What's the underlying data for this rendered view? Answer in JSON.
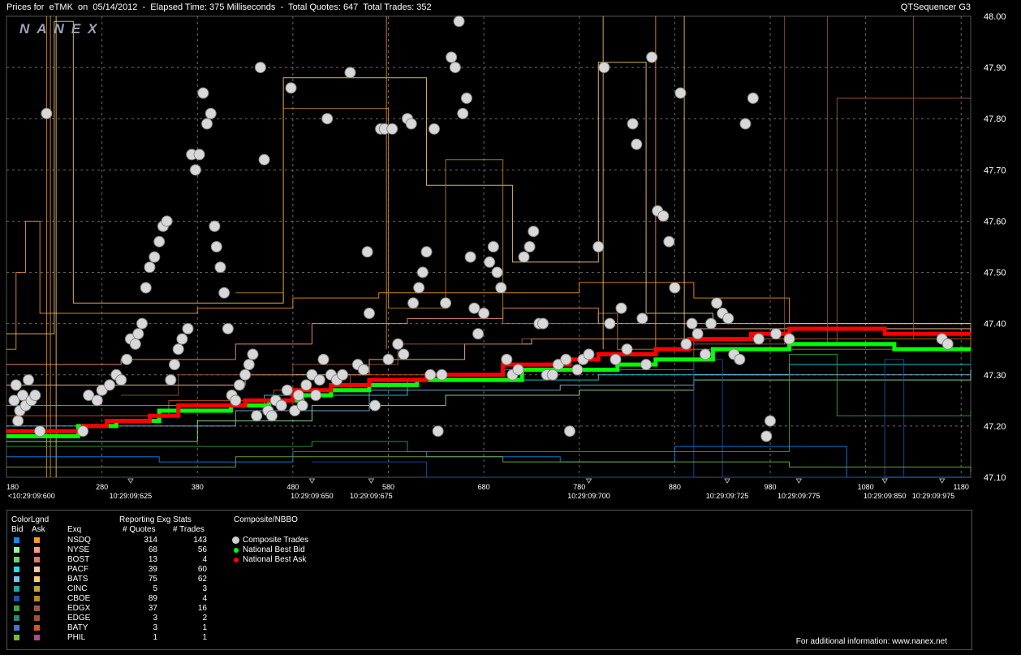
{
  "header": {
    "title": "Prices for  eTMK  on  05/14/2012  -  Elapsed Time: 375 Milliseconds  -  Total Quotes: 647  Total Trades: 352",
    "app_name": "QTSequencer G3",
    "watermark": "NANEX"
  },
  "chart_data": {
    "type": "scatter",
    "title": "Prices for eTMK on 05/14/2012",
    "ylim": [
      47.1,
      48.0
    ],
    "y_ticks": [
      "48.00",
      "47.90",
      "47.80",
      "47.70",
      "47.60",
      "47.50",
      "47.40",
      "47.30",
      "47.20",
      "47.10"
    ],
    "xlim": [
      180,
      1190
    ],
    "x_ticks": [
      "180",
      "280",
      "380",
      "480",
      "580",
      "680",
      "780",
      "880",
      "980",
      "1080",
      "1180"
    ],
    "x_tick_values": [
      180,
      280,
      380,
      480,
      580,
      680,
      780,
      880,
      980,
      1080,
      1180
    ],
    "time_labels": [
      {
        "x": 180,
        "label": "<10:29:09:600"
      },
      {
        "x": 310,
        "label": "10:29:09:625"
      },
      {
        "x": 500,
        "label": "10:29:09:650"
      },
      {
        "x": 562,
        "label": "10:29:09:675"
      },
      {
        "x": 790,
        "label": "10:29:09:700"
      },
      {
        "x": 935,
        "label": "10:29:09:725"
      },
      {
        "x": 1010,
        "label": "10:29:09:775"
      },
      {
        "x": 1100,
        "label": "10:29:09:850"
      },
      {
        "x": 1160,
        "label": "10:29:09:975"
      }
    ],
    "grid": true,
    "nbbo_bid": [
      [
        180,
        47.18
      ],
      [
        255,
        47.18
      ],
      [
        255,
        47.2
      ],
      [
        295,
        47.2
      ],
      [
        295,
        47.21
      ],
      [
        340,
        47.21
      ],
      [
        340,
        47.23
      ],
      [
        415,
        47.23
      ],
      [
        415,
        47.24
      ],
      [
        455,
        47.24
      ],
      [
        455,
        47.25
      ],
      [
        490,
        47.25
      ],
      [
        490,
        47.26
      ],
      [
        520,
        47.26
      ],
      [
        520,
        47.27
      ],
      [
        560,
        47.27
      ],
      [
        560,
        47.28
      ],
      [
        610,
        47.28
      ],
      [
        610,
        47.29
      ],
      [
        720,
        47.29
      ],
      [
        720,
        47.31
      ],
      [
        820,
        47.31
      ],
      [
        820,
        47.32
      ],
      [
        860,
        47.32
      ],
      [
        860,
        47.33
      ],
      [
        920,
        47.33
      ],
      [
        920,
        47.35
      ],
      [
        1000,
        47.35
      ],
      [
        1000,
        47.36
      ],
      [
        1110,
        47.36
      ],
      [
        1110,
        47.35
      ],
      [
        1190,
        47.35
      ]
    ],
    "nbbo_ask": [
      [
        180,
        47.19
      ],
      [
        260,
        47.19
      ],
      [
        260,
        47.2
      ],
      [
        285,
        47.2
      ],
      [
        285,
        47.21
      ],
      [
        330,
        47.21
      ],
      [
        330,
        47.22
      ],
      [
        360,
        47.22
      ],
      [
        360,
        47.24
      ],
      [
        430,
        47.24
      ],
      [
        430,
        47.25
      ],
      [
        480,
        47.25
      ],
      [
        480,
        47.27
      ],
      [
        520,
        47.27
      ],
      [
        520,
        47.28
      ],
      [
        560,
        47.28
      ],
      [
        560,
        47.29
      ],
      [
        620,
        47.29
      ],
      [
        620,
        47.3
      ],
      [
        700,
        47.3
      ],
      [
        700,
        47.32
      ],
      [
        770,
        47.32
      ],
      [
        770,
        47.33
      ],
      [
        800,
        47.33
      ],
      [
        800,
        47.34
      ],
      [
        860,
        47.34
      ],
      [
        860,
        47.35
      ],
      [
        895,
        47.35
      ],
      [
        895,
        47.37
      ],
      [
        960,
        47.37
      ],
      [
        960,
        47.38
      ],
      [
        1000,
        47.38
      ],
      [
        1000,
        47.39
      ],
      [
        1100,
        47.39
      ],
      [
        1100,
        47.38
      ],
      [
        1190,
        47.38
      ]
    ],
    "trades": [
      [
        188,
        47.25
      ],
      [
        190,
        47.28
      ],
      [
        192,
        47.21
      ],
      [
        194,
        47.23
      ],
      [
        197,
        47.26
      ],
      [
        200,
        47.24
      ],
      [
        203,
        47.29
      ],
      [
        206,
        47.25
      ],
      [
        210,
        47.26
      ],
      [
        215,
        47.19
      ],
      [
        222,
        47.81
      ],
      [
        260,
        47.19
      ],
      [
        266,
        47.26
      ],
      [
        275,
        47.25
      ],
      [
        280,
        47.27
      ],
      [
        288,
        47.28
      ],
      [
        295,
        47.3
      ],
      [
        300,
        47.29
      ],
      [
        306,
        47.33
      ],
      [
        310,
        47.37
      ],
      [
        315,
        47.36
      ],
      [
        318,
        47.38
      ],
      [
        322,
        47.4
      ],
      [
        326,
        47.47
      ],
      [
        330,
        47.51
      ],
      [
        335,
        47.53
      ],
      [
        340,
        47.56
      ],
      [
        344,
        47.59
      ],
      [
        348,
        47.6
      ],
      [
        352,
        47.29
      ],
      [
        356,
        47.32
      ],
      [
        360,
        47.35
      ],
      [
        364,
        47.37
      ],
      [
        370,
        47.39
      ],
      [
        374,
        47.73
      ],
      [
        378,
        47.7
      ],
      [
        382,
        47.73
      ],
      [
        386,
        47.85
      ],
      [
        390,
        47.79
      ],
      [
        394,
        47.81
      ],
      [
        398,
        47.59
      ],
      [
        400,
        47.55
      ],
      [
        404,
        47.51
      ],
      [
        408,
        47.46
      ],
      [
        412,
        47.39
      ],
      [
        416,
        47.26
      ],
      [
        420,
        47.25
      ],
      [
        424,
        47.28
      ],
      [
        430,
        47.3
      ],
      [
        434,
        47.32
      ],
      [
        438,
        47.34
      ],
      [
        442,
        47.22
      ],
      [
        446,
        47.9
      ],
      [
        450,
        47.72
      ],
      [
        454,
        47.23
      ],
      [
        458,
        47.22
      ],
      [
        462,
        47.25
      ],
      [
        468,
        47.24
      ],
      [
        474,
        47.27
      ],
      [
        478,
        47.86
      ],
      [
        482,
        47.23
      ],
      [
        486,
        47.26
      ],
      [
        490,
        47.24
      ],
      [
        494,
        47.28
      ],
      [
        500,
        47.3
      ],
      [
        504,
        47.26
      ],
      [
        508,
        47.29
      ],
      [
        512,
        47.33
      ],
      [
        516,
        47.8
      ],
      [
        520,
        47.3
      ],
      [
        526,
        47.29
      ],
      [
        532,
        47.3
      ],
      [
        540,
        47.89
      ],
      [
        548,
        47.32
      ],
      [
        554,
        47.31
      ],
      [
        558,
        47.54
      ],
      [
        560,
        47.42
      ],
      [
        566,
        47.24
      ],
      [
        572,
        47.78
      ],
      [
        576,
        47.78
      ],
      [
        580,
        47.33
      ],
      [
        584,
        47.78
      ],
      [
        590,
        47.36
      ],
      [
        596,
        47.34
      ],
      [
        600,
        47.8
      ],
      [
        604,
        47.79
      ],
      [
        606,
        47.44
      ],
      [
        612,
        47.47
      ],
      [
        616,
        47.5
      ],
      [
        620,
        47.54
      ],
      [
        624,
        47.3
      ],
      [
        628,
        47.78
      ],
      [
        632,
        47.19
      ],
      [
        636,
        47.3
      ],
      [
        640,
        47.44
      ],
      [
        646,
        47.92
      ],
      [
        650,
        47.9
      ],
      [
        654,
        47.99
      ],
      [
        658,
        47.81
      ],
      [
        662,
        47.84
      ],
      [
        666,
        47.53
      ],
      [
        670,
        47.43
      ],
      [
        674,
        47.38
      ],
      [
        680,
        47.42
      ],
      [
        686,
        47.52
      ],
      [
        690,
        47.55
      ],
      [
        694,
        47.5
      ],
      [
        698,
        47.47
      ],
      [
        704,
        47.33
      ],
      [
        710,
        47.3
      ],
      [
        716,
        47.31
      ],
      [
        722,
        47.53
      ],
      [
        728,
        47.55
      ],
      [
        732,
        47.58
      ],
      [
        738,
        47.4
      ],
      [
        742,
        47.4
      ],
      [
        746,
        47.3
      ],
      [
        752,
        47.3
      ],
      [
        758,
        47.32
      ],
      [
        766,
        47.33
      ],
      [
        770,
        47.19
      ],
      [
        778,
        47.31
      ],
      [
        784,
        47.33
      ],
      [
        790,
        47.34
      ],
      [
        800,
        47.55
      ],
      [
        806,
        47.9
      ],
      [
        812,
        47.4
      ],
      [
        818,
        47.33
      ],
      [
        824,
        47.43
      ],
      [
        830,
        47.35
      ],
      [
        836,
        47.79
      ],
      [
        840,
        47.75
      ],
      [
        846,
        47.41
      ],
      [
        850,
        47.32
      ],
      [
        856,
        47.92
      ],
      [
        862,
        47.62
      ],
      [
        868,
        47.61
      ],
      [
        874,
        47.56
      ],
      [
        880,
        47.47
      ],
      [
        886,
        47.85
      ],
      [
        892,
        47.36
      ],
      [
        898,
        47.4
      ],
      [
        904,
        47.38
      ],
      [
        912,
        47.34
      ],
      [
        918,
        47.4
      ],
      [
        924,
        47.44
      ],
      [
        930,
        47.42
      ],
      [
        936,
        47.41
      ],
      [
        942,
        47.34
      ],
      [
        948,
        47.33
      ],
      [
        954,
        47.79
      ],
      [
        962,
        47.84
      ],
      [
        968,
        47.37
      ],
      [
        976,
        47.18
      ],
      [
        980,
        47.21
      ],
      [
        986,
        47.38
      ],
      [
        1000,
        47.37
      ],
      [
        1160,
        47.37
      ],
      [
        1166,
        47.36
      ]
    ],
    "annotations": []
  },
  "legend": {
    "color_legend_title": "ColorLgnd",
    "bid_label": "Bid",
    "ask_label": "Ask",
    "exq_label": "Exq",
    "stats_title": "Reporting Exg Stats",
    "quotes_header": "# Quotes",
    "trades_header": "# Trades",
    "composite_title": "Composite/NBBO",
    "exchanges": [
      {
        "name": "NSDQ",
        "quotes": "314",
        "trades": "143",
        "bid_color": "#0a8cff",
        "ask_color": "#ff9a1a"
      },
      {
        "name": "NYSE",
        "quotes": "68",
        "trades": "56",
        "bid_color": "#9cf29c",
        "ask_color": "#ff9a8a"
      },
      {
        "name": "BOST",
        "quotes": "13",
        "trades": "4",
        "bid_color": "#6bd46b",
        "ask_color": "#e07a6a"
      },
      {
        "name": "PACF",
        "quotes": "39",
        "trades": "60",
        "bid_color": "#1ae0f0",
        "ask_color": "#ffc89a"
      },
      {
        "name": "BATS",
        "quotes": "75",
        "trades": "62",
        "bid_color": "#7ac0f0",
        "ask_color": "#ffd070"
      },
      {
        "name": "CINC",
        "quotes": "5",
        "trades": "3",
        "bid_color": "#1aa8a8",
        "ask_color": "#c0a838"
      },
      {
        "name": "CBOE",
        "quotes": "89",
        "trades": "4",
        "bid_color": "#1a50b0",
        "ask_color": "#c08a1a"
      },
      {
        "name": "EDGX",
        "quotes": "37",
        "trades": "16",
        "bid_color": "#3aa83a",
        "ask_color": "#a05a3a"
      },
      {
        "name": "EDGE",
        "quotes": "3",
        "trades": "2",
        "bid_color": "#2a8a6a",
        "ask_color": "#a0503a"
      },
      {
        "name": "BATY",
        "quotes": "3",
        "trades": "1",
        "bid_color": "#3a7ad0",
        "ask_color": "#d05a1a"
      },
      {
        "name": "PHIL",
        "quotes": "1",
        "trades": "1",
        "bid_color": "#7ab838",
        "ask_color": "#b04a8a"
      }
    ],
    "composite_items": [
      {
        "label": "Composite Trades",
        "color": "#d0d0d0"
      },
      {
        "label": "National Best Bid",
        "color": "#00ff00"
      },
      {
        "label": "National Best Ask",
        "color": "#ff0000"
      }
    ],
    "footer": "For additional information: www.nanex.net"
  }
}
